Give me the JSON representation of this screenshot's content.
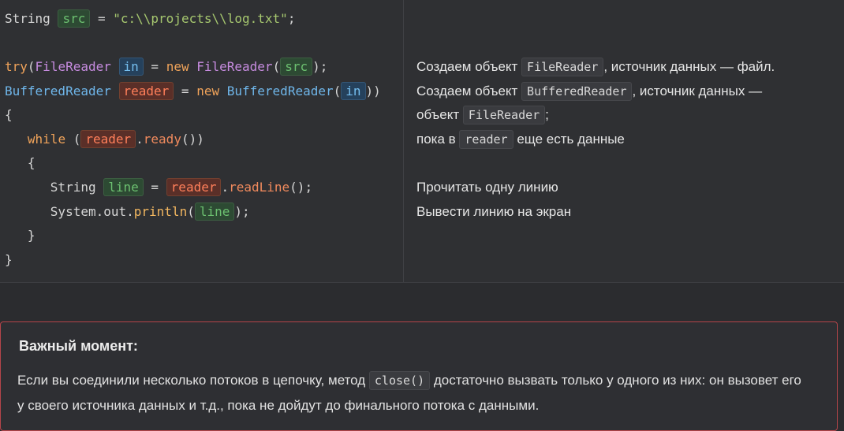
{
  "code": {
    "l1": {
      "a": "String ",
      "b": "src",
      "c": " = ",
      "d": "\"c:\\\\projects\\\\log.txt\"",
      "e": ";"
    },
    "l2": {
      "a": "try",
      "b": "(",
      "c": "FileReader",
      "d": " ",
      "e": "in",
      "f": " = ",
      "g": "new",
      "h": " ",
      "i": "FileReader",
      "j": "(",
      "k": "src",
      "l": ");"
    },
    "l3": {
      "a": "BufferedReader",
      "b": " ",
      "c": "reader",
      "d": " = ",
      "e": "new",
      "f": " ",
      "g": "BufferedReader",
      "h": "(",
      "i": "in",
      "j": "))"
    },
    "l4": {
      "a": "{"
    },
    "l5": {
      "a": "   ",
      "b": "while",
      "c": " (",
      "d": "reader",
      "e": ".",
      "f": "ready",
      "g": "())"
    },
    "l6": {
      "a": "   {"
    },
    "l7": {
      "a": "      String ",
      "b": "line",
      "c": " = ",
      "d": "reader",
      "e": ".",
      "f": "readLine",
      "g": "();"
    },
    "l8": {
      "a": "      System.out.",
      "b": "println",
      "c": "(",
      "d": "line",
      "e": ");"
    },
    "l9": {
      "a": "   }"
    },
    "l10": {
      "a": "}"
    }
  },
  "desc": {
    "d1": {
      "a": "Создаем объект ",
      "b": "FileReader",
      "c": ", источник данных — файл."
    },
    "d2": {
      "a": "Создаем объект ",
      "b": "BufferedReader",
      "c": ", источник данных —"
    },
    "d3": {
      "a": "объект ",
      "b": "FileReader",
      "c": ";"
    },
    "d4": {
      "a": "пока в ",
      "b": "reader",
      "c": " еще есть данные"
    },
    "d5": {
      "a": "Прочитать одну линию"
    },
    "d6": {
      "a": "Вывести линию на экран"
    }
  },
  "note": {
    "title": "Важный момент:",
    "t1": "Если вы соединили несколько потоков в цепочку, метод ",
    "code": "close()",
    "t2": " достаточно вызвать только у одного из них: он вызовет его у своего источника данных и т.д., пока не дойдут до финального потока с данными."
  }
}
